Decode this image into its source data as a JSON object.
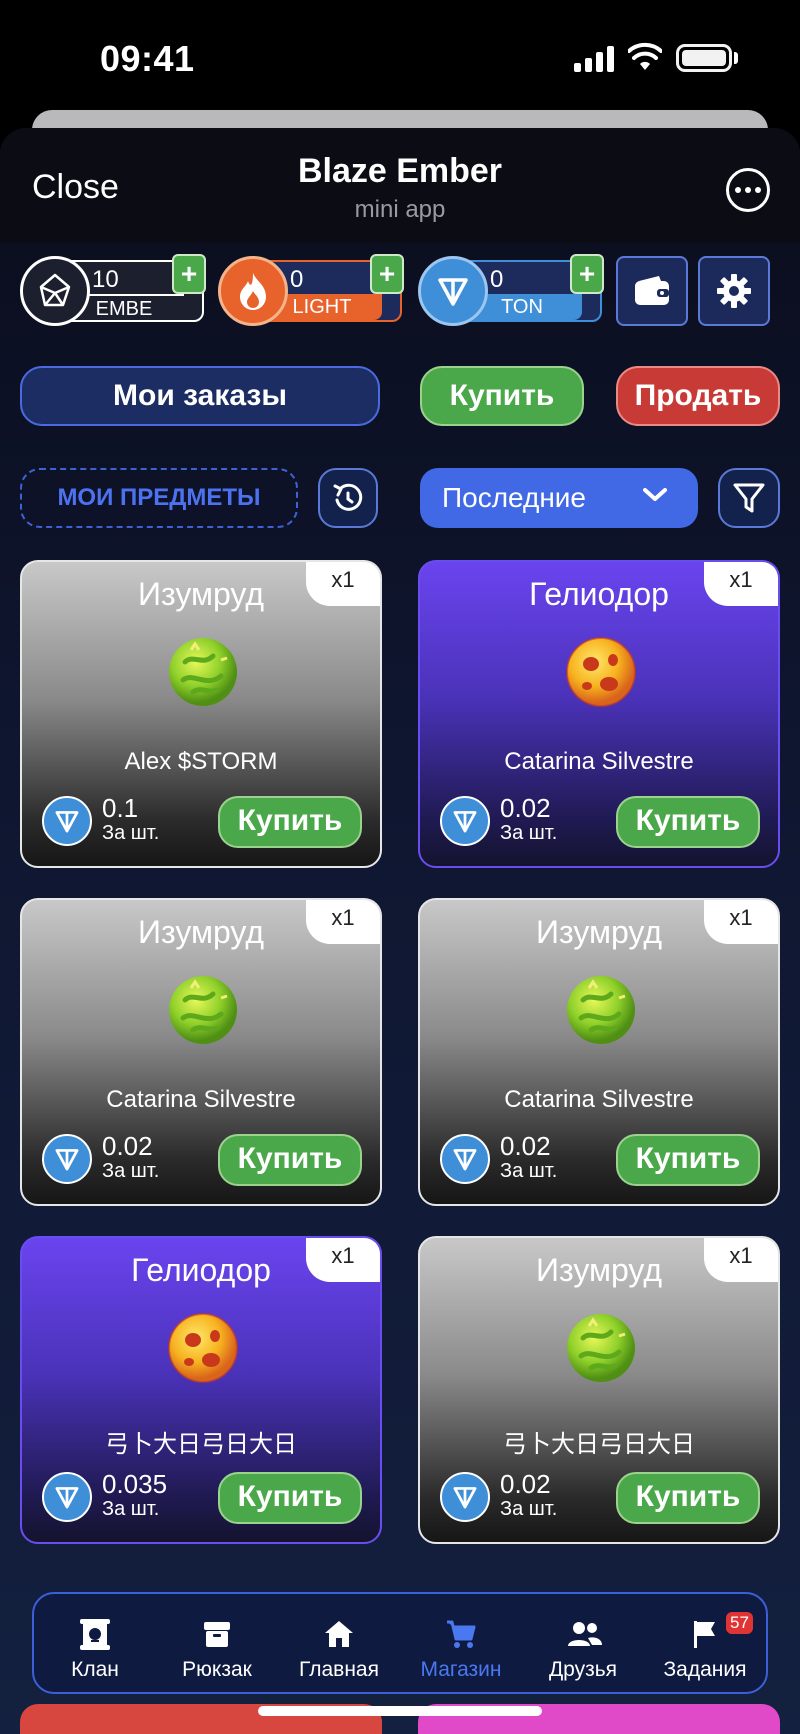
{
  "status": {
    "time": "09:41"
  },
  "header": {
    "close_label": "Close",
    "title": "Blaze Ember",
    "subtitle": "mini app"
  },
  "currencies": [
    {
      "value": "10",
      "label": "EMBE",
      "color": "#1c1f2e"
    },
    {
      "value": "0",
      "label": "LIGHT",
      "color": "#e8622b"
    },
    {
      "value": "0",
      "label": "TON",
      "color": "#3f8fd8"
    }
  ],
  "actions": {
    "orders": "Мои заказы",
    "buy": "Купить",
    "sell": "Продать",
    "my_items": "МОИ ПРЕДМЕТЫ",
    "sort": "Последние"
  },
  "cards": [
    {
      "name": "Изумруд",
      "qty": "x1",
      "seller": "Alex $STORM",
      "price": "0.1",
      "per": "За шт.",
      "buy": "Купить",
      "theme": "gray",
      "gem": "emerald"
    },
    {
      "name": "Гелиодор",
      "qty": "x1",
      "seller": "Catarina Silvestre",
      "price": "0.02",
      "per": "За шт.",
      "buy": "Купить",
      "theme": "purple",
      "gem": "heliodor"
    },
    {
      "name": "Изумруд",
      "qty": "x1",
      "seller": "Catarina Silvestre",
      "price": "0.02",
      "per": "За шт.",
      "buy": "Купить",
      "theme": "gray",
      "gem": "emerald"
    },
    {
      "name": "Изумруд",
      "qty": "x1",
      "seller": "Catarina Silvestre",
      "price": "0.02",
      "per": "За шт.",
      "buy": "Купить",
      "theme": "gray",
      "gem": "emerald"
    },
    {
      "name": "Гелиодор",
      "qty": "x1",
      "seller": "弓卜大日弓日大日",
      "price": "0.035",
      "per": "За шт.",
      "buy": "Купить",
      "theme": "purple",
      "gem": "heliodor"
    },
    {
      "name": "Изумруд",
      "qty": "x1",
      "seller": "弓卜大日弓日大日",
      "price": "0.02",
      "per": "За шт.",
      "buy": "Купить",
      "theme": "gray",
      "gem": "emerald"
    }
  ],
  "nav": [
    {
      "label": "Клан",
      "icon": "clan-icon"
    },
    {
      "label": "Рюкзак",
      "icon": "backpack-icon"
    },
    {
      "label": "Главная",
      "icon": "home-icon"
    },
    {
      "label": "Магазин",
      "icon": "cart-icon",
      "active": true
    },
    {
      "label": "Друзья",
      "icon": "friends-icon"
    },
    {
      "label": "Задания",
      "icon": "flag-icon",
      "badge": "57"
    }
  ],
  "colors": {
    "active_nav": "#4a78f0",
    "buy_green": "#4ba84a",
    "sell_red": "#c83a36",
    "accent_blue": "#4169e6"
  }
}
